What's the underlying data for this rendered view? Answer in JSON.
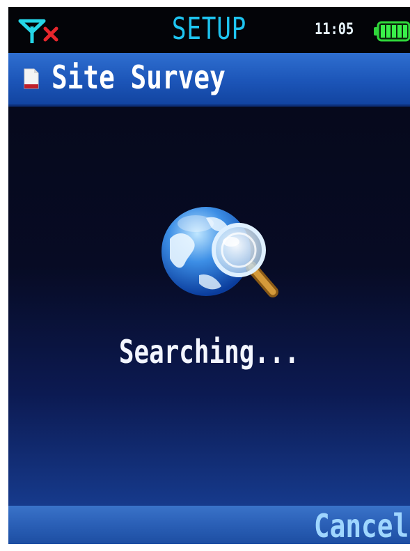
{
  "status_bar": {
    "title": "SETUP",
    "time": "11:05",
    "signal_icon": "antenna-icon",
    "no_signal_icon": "no-service-x-icon",
    "battery_icon": "battery-full-icon",
    "battery_level": 1.0,
    "accent_color": "#1ec4f0",
    "battery_color": "#2fd63a"
  },
  "title_bar": {
    "icon": "document-icon",
    "title": "Site Survey",
    "color": "#1c55b8"
  },
  "main": {
    "graphic_icon": "globe-search-icon",
    "message": "Searching..."
  },
  "softkeys": {
    "right_label": "Cancel"
  }
}
